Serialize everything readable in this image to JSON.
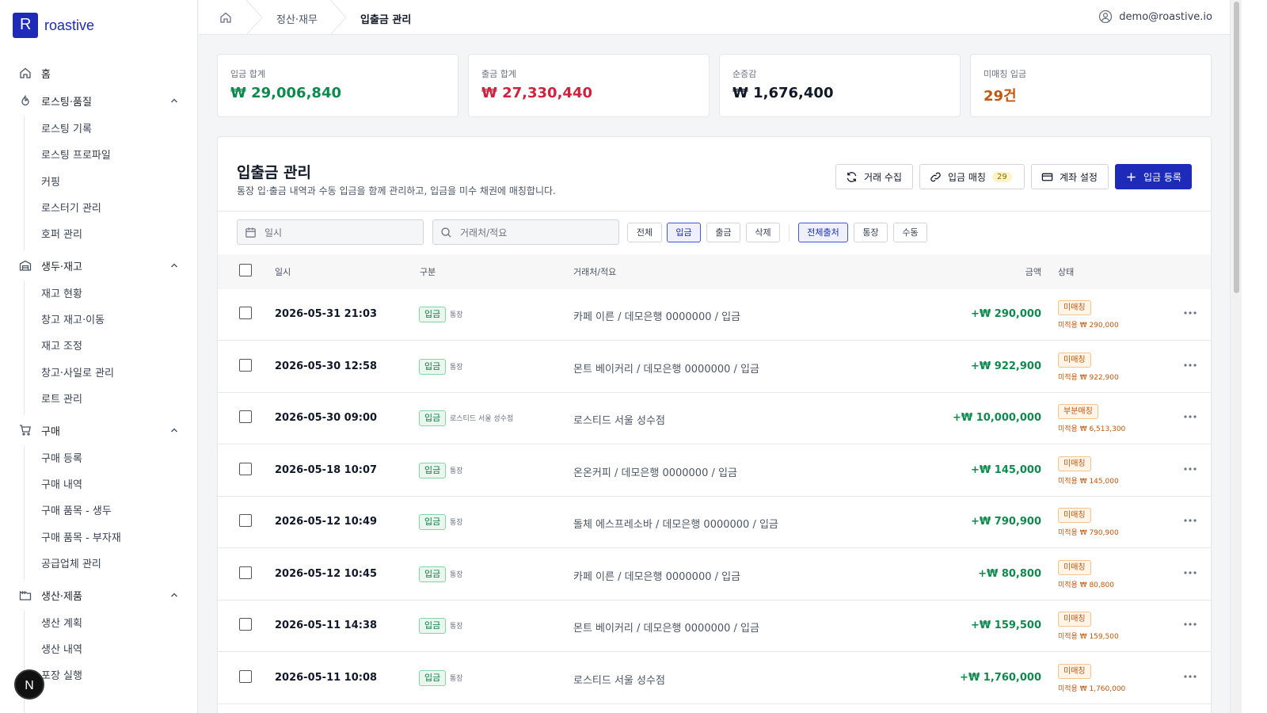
{
  "brand": {
    "name": "roastive",
    "mark": "R",
    "color": "#1d2bb8"
  },
  "sidebar": {
    "home": "홈",
    "sections": [
      {
        "label": "로스팅·품질",
        "items": [
          "로스팅 기록",
          "로스팅 프로파일",
          "커핑",
          "로스터기 관리",
          "호퍼 관리"
        ]
      },
      {
        "label": "생두·재고",
        "items": [
          "재고 현황",
          "창고 재고·이동",
          "재고 조정",
          "창고·사일로 관리",
          "로트 관리"
        ]
      },
      {
        "label": "구매",
        "items": [
          "구매 등록",
          "구매 내역",
          "구매 품목 - 생두",
          "구매 품목 - 부자재",
          "공급업체 관리"
        ]
      },
      {
        "label": "생산·제품",
        "items": [
          "생산 계획",
          "생산 내역",
          "포장 실행"
        ]
      }
    ],
    "floating_avatar": "N"
  },
  "header": {
    "breadcrumb": [
      "정산·재무",
      "입출금 관리"
    ],
    "user_email": "demo@roastive.io"
  },
  "stats": [
    {
      "label": "입금 합계",
      "value": "₩ 29,006,840",
      "color": "#0f8a4f"
    },
    {
      "label": "출금 합계",
      "value": "₩ 27,330,440",
      "color": "#d0213f"
    },
    {
      "label": "순증감",
      "value": "₩ 1,676,400",
      "color": "#111827"
    },
    {
      "label": "미매칭 입금",
      "value": "29건",
      "color": "#c2560c"
    }
  ],
  "panel": {
    "title": "입출금 관리",
    "description": "통장 입·출금 내역과 수동 입금을 함께 관리하고, 입금을 미수 채권에 매칭합니다.",
    "buttons": {
      "collect": "거래 수집",
      "match": "입금 매칭",
      "match_count": "29",
      "account": "계좌 설정",
      "register": "입금 등록"
    },
    "filters": {
      "date_placeholder": "일시",
      "search_placeholder": "거래처/적요",
      "type_chips": [
        "전체",
        "입금",
        "출금",
        "삭제"
      ],
      "type_active": "입금",
      "source_chips": [
        "전체출처",
        "통장",
        "수동"
      ],
      "source_active": "전체출처"
    },
    "columns": [
      "일시",
      "구분",
      "거래처/적요",
      "금액",
      "상태"
    ]
  },
  "rows": [
    {
      "date": "2026-05-31 21:03",
      "type": "입금",
      "source": "통장",
      "desc": "카페 이른 / 데모은행 0000000 / 입금",
      "amount": "+₩ 290,000",
      "status": "미매칭",
      "remaining": "미적용 ₩ 290,000"
    },
    {
      "date": "2026-05-30 12:58",
      "type": "입금",
      "source": "통장",
      "desc": "몬트 베이커리 / 데모은행 0000000 / 입금",
      "amount": "+₩ 922,900",
      "status": "미매칭",
      "remaining": "미적용 ₩ 922,900"
    },
    {
      "date": "2026-05-30 09:00",
      "type": "입금",
      "source": "로스티드 서울 성수점",
      "desc": "로스티드 서울 성수점",
      "amount": "+₩ 10,000,000",
      "status": "부분매칭",
      "remaining": "미적용 ₩ 6,513,300"
    },
    {
      "date": "2026-05-18 10:07",
      "type": "입금",
      "source": "통장",
      "desc": "온온커피 / 데모은행 0000000 / 입금",
      "amount": "+₩ 145,000",
      "status": "미매칭",
      "remaining": "미적용 ₩ 145,000"
    },
    {
      "date": "2026-05-12 10:49",
      "type": "입금",
      "source": "통장",
      "desc": "돌체 에스프레소바 / 데모은행 0000000 / 입금",
      "amount": "+₩ 790,900",
      "status": "미매칭",
      "remaining": "미적용 ₩ 790,900"
    },
    {
      "date": "2026-05-12 10:45",
      "type": "입금",
      "source": "통장",
      "desc": "카페 이른 / 데모은행 0000000 / 입금",
      "amount": "+₩ 80,800",
      "status": "미매칭",
      "remaining": "미적용 ₩ 80,800"
    },
    {
      "date": "2026-05-11 14:38",
      "type": "입금",
      "source": "통장",
      "desc": "몬트 베이커리 / 데모은행 0000000 / 입금",
      "amount": "+₩ 159,500",
      "status": "미매칭",
      "remaining": "미적용 ₩ 159,500"
    },
    {
      "date": "2026-05-11 10:08",
      "type": "입금",
      "source": "통장",
      "desc": "로스티드 서울 성수점",
      "amount": "+₩ 1,760,000",
      "status": "미매칭",
      "remaining": "미적용 ₩ 1,760,000"
    }
  ]
}
